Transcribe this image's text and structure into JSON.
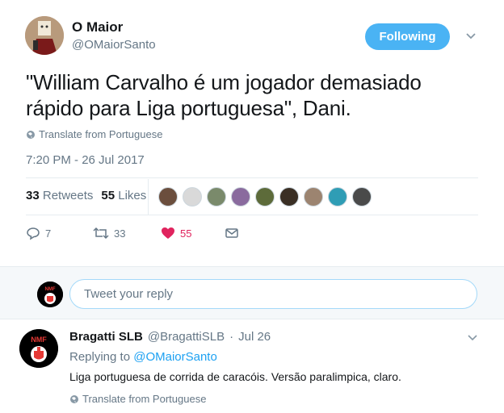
{
  "tweet": {
    "name": "O Maior",
    "handle": "@OMaiorSanto",
    "follow_label": "Following",
    "text": "\"William Carvalho é um jogador demasiado rápido para Liga portuguesa\", Dani.",
    "translate_label": "Translate from Portuguese",
    "timestamp": "7:20 PM - 26 Jul 2017",
    "retweets_count": "33",
    "retweets_label": "Retweets",
    "likes_count": "55",
    "likes_label": "Likes",
    "actions": {
      "reply_count": "7",
      "retweet_count": "33",
      "like_count": "55"
    },
    "colors": {
      "accent": "#1da1f2",
      "follow_bg": "#4ab3f4",
      "like": "#e0245e",
      "muted": "#657786"
    }
  },
  "likers": [
    {
      "icon": "avatar",
      "color": "#6b4e3d"
    },
    {
      "icon": "avatar",
      "color": "#d9d9d9"
    },
    {
      "icon": "avatar",
      "color": "#7a8a6b"
    },
    {
      "icon": "avatar",
      "color": "#8a6b9e"
    },
    {
      "icon": "avatar",
      "color": "#5d6b3a"
    },
    {
      "icon": "avatar",
      "color": "#3a2f24"
    },
    {
      "icon": "avatar",
      "color": "#9c8470"
    },
    {
      "icon": "avatar",
      "color": "#2f9db5"
    },
    {
      "icon": "avatar",
      "color": "#4a4a4a"
    }
  ],
  "reply_box": {
    "placeholder": "Tweet your reply"
  },
  "reply": {
    "name": "Bragatti SLB",
    "handle": "@BragattiSLB",
    "date": "Jul 26",
    "replying_prefix": "Replying to",
    "replying_to": "@OMaiorSanto",
    "text": "Liga portuguesa de corrida de caracóis. Versão paralimpica, claro.",
    "translate_label": "Translate from Portuguese"
  }
}
